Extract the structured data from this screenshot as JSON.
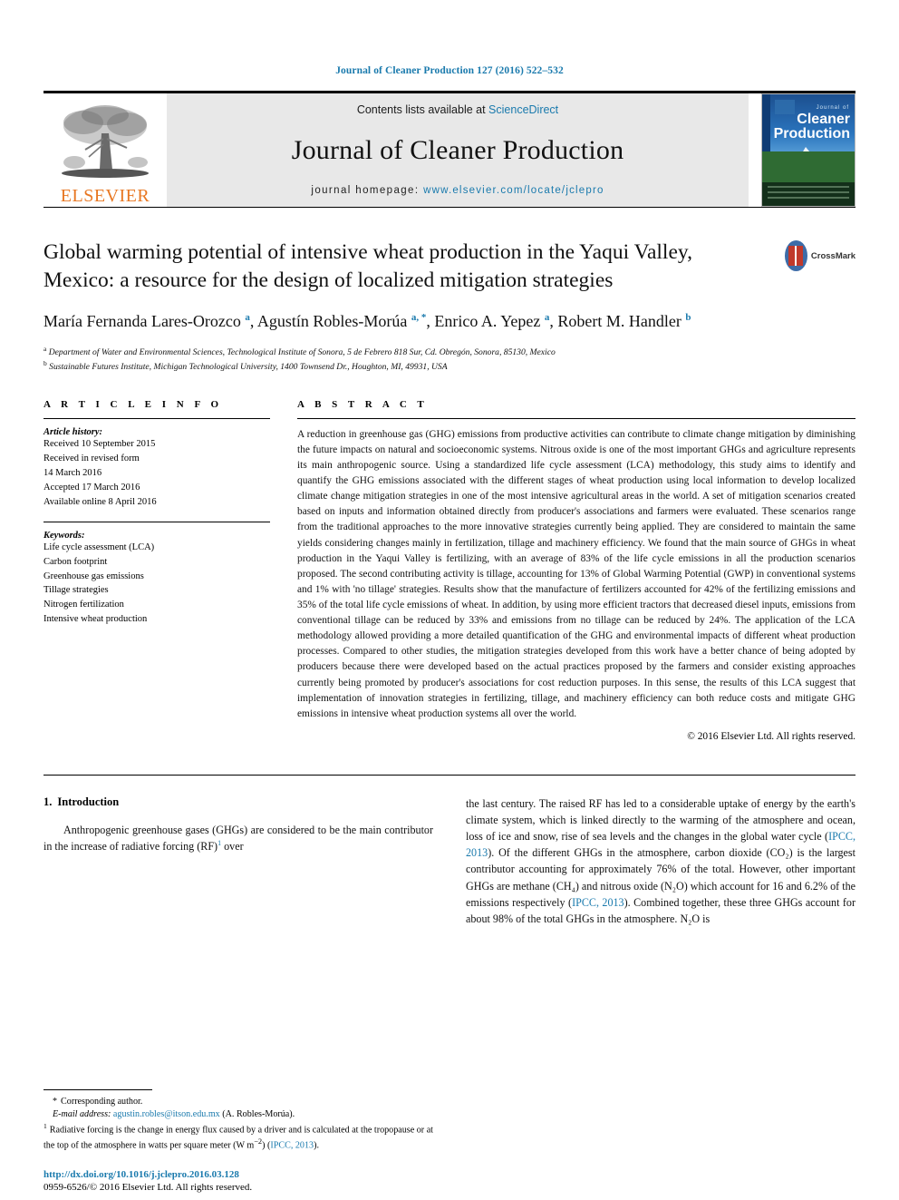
{
  "running_head": "Journal of Cleaner Production 127 (2016) 522–532",
  "masthead": {
    "contents_prefix": "Contents lists available at ",
    "sciencedirect": "ScienceDirect",
    "journal_title": "Journal of Cleaner Production",
    "homepage_prefix": "journal homepage: ",
    "homepage_url": "www.elsevier.com/locate/jclepro",
    "publisher": "ELSEVIER",
    "cover": {
      "journal_of": "Journal of",
      "line1": "Cleaner",
      "line2": "Production"
    },
    "link_color": "#1a7aad"
  },
  "article": {
    "title": "Global warming potential of intensive wheat production in the Yaqui Valley, Mexico: a resource for the design of localized mitigation strategies",
    "crossmark_label": "CrossMark",
    "authors_html": "María Fernanda Lares-Orozco <sup>a</sup>, Agustín Robles-Morúa <sup>a, *</sup>, Enrico A. Yepez <sup>a</sup>, Robert M. Handler <sup>b</sup>",
    "affiliations": [
      {
        "marker": "a",
        "text": "Department of Water and Environmental Sciences, Technological Institute of Sonora, 5 de Febrero 818 Sur, Cd. Obregón, Sonora, 85130, Mexico"
      },
      {
        "marker": "b",
        "text": "Sustainable Futures Institute, Michigan Technological University, 1400 Townsend Dr., Houghton, MI, 49931, USA"
      }
    ]
  },
  "article_info": {
    "heading": "A R T I C L E   I N F O",
    "history_label": "Article history:",
    "history": [
      "Received 10 September 2015",
      "Received in revised form",
      "14 March 2016",
      "Accepted 17 March 2016",
      "Available online 8 April 2016"
    ],
    "keywords_label": "Keywords:",
    "keywords": [
      "Life cycle assessment (LCA)",
      "Carbon footprint",
      "Greenhouse gas emissions",
      "Tillage strategies",
      "Nitrogen fertilization",
      "Intensive wheat production"
    ]
  },
  "abstract": {
    "heading": "A B S T R A C T",
    "text": "A reduction in greenhouse gas (GHG) emissions from productive activities can contribute to climate change mitigation by diminishing the future impacts on natural and socioeconomic systems. Nitrous oxide is one of the most important GHGs and agriculture represents its main anthropogenic source. Using a standardized life cycle assessment (LCA) methodology, this study aims to identify and quantify the GHG emissions associated with the different stages of wheat production using local information to develop localized climate change mitigation strategies in one of the most intensive agricultural areas in the world. A set of mitigation scenarios created based on inputs and information obtained directly from producer's associations and farmers were evaluated. These scenarios range from the traditional approaches to the more innovative strategies currently being applied. They are considered to maintain the same yields considering changes mainly in fertilization, tillage and machinery efficiency. We found that the main source of GHGs in wheat production in the Yaqui Valley is fertilizing, with an average of 83% of the life cycle emissions in all the production scenarios proposed. The second contributing activity is tillage, accounting for 13% of Global Warming Potential (GWP) in conventional systems and 1% with 'no tillage' strategies. Results show that the manufacture of fertilizers accounted for 42% of the fertilizing emissions and 35% of the total life cycle emissions of wheat. In addition, by using more efficient tractors that decreased diesel inputs, emissions from conventional tillage can be reduced by 33% and emissions from no tillage can be reduced by 24%. The application of the LCA methodology allowed providing a more detailed quantification of the GHG and environmental impacts of different wheat production processes. Compared to other studies, the mitigation strategies developed from this work have a better chance of being adopted by producers because there were developed based on the actual practices proposed by the farmers and consider existing approaches currently being promoted by producer's associations for cost reduction purposes. In this sense, the results of this LCA suggest that implementation of innovation strategies in fertilizing, tillage, and machinery efficiency can both reduce costs and mitigate GHG emissions in intensive wheat production systems all over the world.",
    "copyright": "© 2016 Elsevier Ltd. All rights reserved."
  },
  "introduction": {
    "number": "1.",
    "heading": "Introduction",
    "left_para_a": "Anthropogenic greenhouse gases (GHGs) are considered to be the main contributor in the increase of radiative forcing (RF)",
    "left_para_note": "1",
    "left_para_b": " over",
    "right_para_1": "the last century. The raised RF has led to a considerable uptake of energy by the earth's climate system, which is linked directly to the warming of the atmosphere and ocean, loss of ice and snow, rise of sea levels and the changes in the global water cycle (",
    "right_cite_1": "IPCC, 2013",
    "right_para_2": "). Of the different GHGs in the atmosphere, carbon dioxide (CO₂) is the largest contributor accounting for approximately 76% of the total. However, other important GHGs are methane (CH₄) and nitrous oxide (N₂O) which account for 16 and 6.2% of the emissions respectively (",
    "right_cite_2": "IPCC, 2013",
    "right_para_3": "). Combined together, these three GHGs account for about 98% of the total GHGs in the atmosphere. N₂O is"
  },
  "footnotes": {
    "corresponding_star": "*",
    "corresponding": "Corresponding author.",
    "email_label": "E-mail address:",
    "email": "agustin.robles@itson.edu.mx",
    "email_suffix": " (A. Robles-Morúa).",
    "note_number": "1",
    "note_text_a": "Radiative forcing is the change in energy flux caused by a driver and is calculated at the tropopause or at the top of the atmosphere in watts per square meter (W m",
    "note_exp": "−2",
    "note_text_b": ") (",
    "note_cite": "IPCC, 2013",
    "note_text_c": ")."
  },
  "footer": {
    "doi": "http://dx.doi.org/10.1016/j.jclepro.2016.03.128",
    "issn": "0959-6526/© 2016 Elsevier Ltd. All rights reserved."
  }
}
